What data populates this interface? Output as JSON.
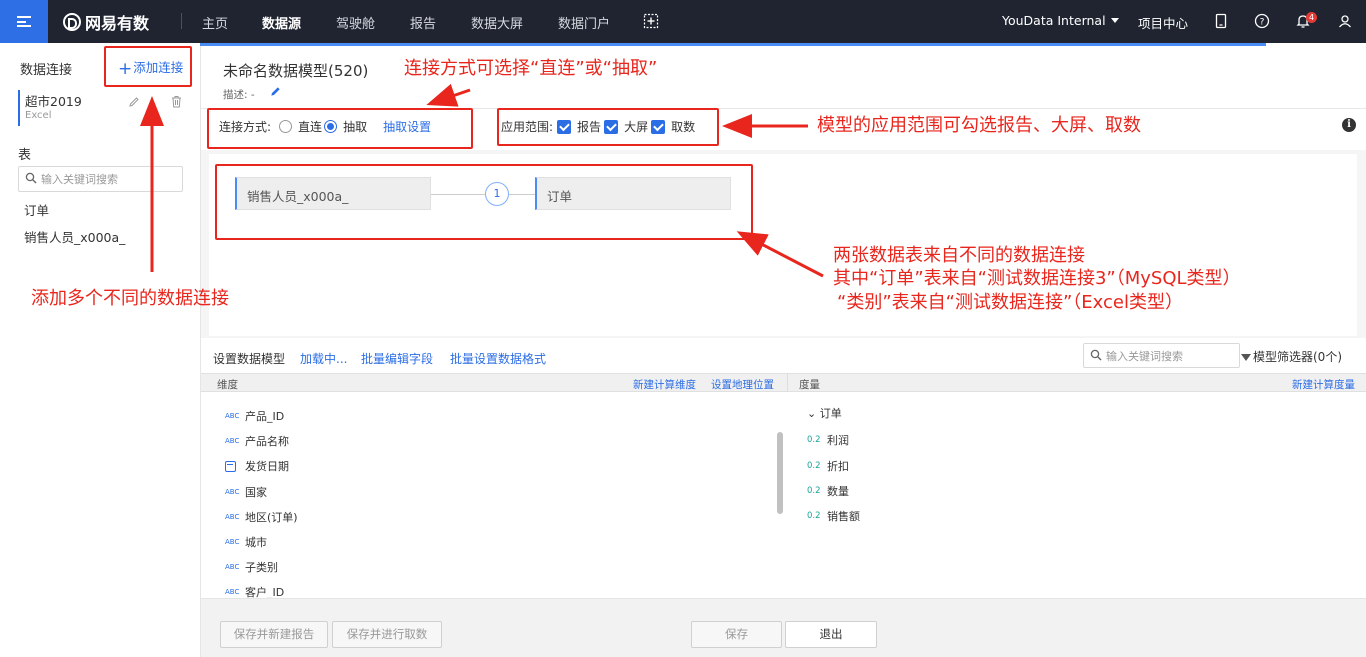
{
  "topnav": {
    "logo_text": "网易有数",
    "items": [
      "主页",
      "数据源",
      "驾驶舱",
      "报告",
      "数据大屏",
      "数据门户"
    ],
    "active_item": "数据源",
    "org_name": "YouData Internal",
    "project_center": "项目中心",
    "notification_count": "4",
    "icons": [
      "menu-icon",
      "logo-icon",
      "add-panel-icon",
      "tablet-icon",
      "help-icon",
      "bell-icon",
      "user-icon"
    ]
  },
  "left": {
    "title": "数据连接",
    "add_connection": "添加连接",
    "connection": {
      "name": "超市2019",
      "type": "Excel"
    },
    "table_section_title": "表",
    "search_placeholder": "输入关键词搜索",
    "tables": [
      "订单",
      "销售人员_x000a_"
    ]
  },
  "main": {
    "model_title": "未命名数据模型(520)",
    "desc_label": "描述: -",
    "connection_mode_label": "连接方式:",
    "mode_direct": "直连",
    "mode_extract": "抽取",
    "selected_mode": "抽取",
    "extract_settings": "抽取设置",
    "scope_label": "应用范围:",
    "scope_options": [
      "报告",
      "大屏",
      "取数"
    ],
    "nodes": {
      "left": "销售人员_x000a_",
      "right": "订单",
      "join_label": "1"
    },
    "toolbar": {
      "set_model": "设置数据模型",
      "loading": "加载中...",
      "batch_edit": "批量编辑字段",
      "batch_format": "批量设置数据格式",
      "search_placeholder": "输入关键词搜索",
      "filter": "模型筛选器(0个)"
    },
    "dimension_header": "维度",
    "new_calc_dimension": "新建计算维度",
    "set_geo": "设置地理位置",
    "measure_header": "度量",
    "new_calc_measure": "新建计算度量",
    "dimensions": [
      {
        "type": "ABC",
        "name": "产品_ID"
      },
      {
        "type": "ABC",
        "name": "产品名称"
      },
      {
        "type": "date",
        "name": "发货日期"
      },
      {
        "type": "ABC",
        "name": "国家"
      },
      {
        "type": "ABC",
        "name": "地区(订单)"
      },
      {
        "type": "ABC",
        "name": "城市"
      },
      {
        "type": "ABC",
        "name": "子类别"
      },
      {
        "type": "ABC",
        "name": "客户_ID"
      }
    ],
    "measure_group": "订单",
    "measures": [
      {
        "type": "0.2",
        "name": "利润"
      },
      {
        "type": "0.2",
        "name": "折扣"
      },
      {
        "type": "0.2",
        "name": "数量"
      },
      {
        "type": "0.2",
        "name": "销售额"
      }
    ],
    "footer": {
      "save_new_report": "保存并新建报告",
      "save_and_extract": "保存并进行取数",
      "save": "保存",
      "exit": "退出"
    }
  },
  "annotations": {
    "mode_note": "连接方式可选择“直连”或“抽取”",
    "scope_note": "模型的应用范围可勾选报告、大屏、取数",
    "tables_note_line1": "两张数据表来自不同的数据连接",
    "tables_note_line2": "其中“订单”表来自“测试数据连接3”（MySQL类型）",
    "tables_note_line3": "“类别”表来自“测试数据连接”（Excel类型）",
    "add_note": "添加多个不同的数据连接",
    "color": "#e8261d"
  }
}
